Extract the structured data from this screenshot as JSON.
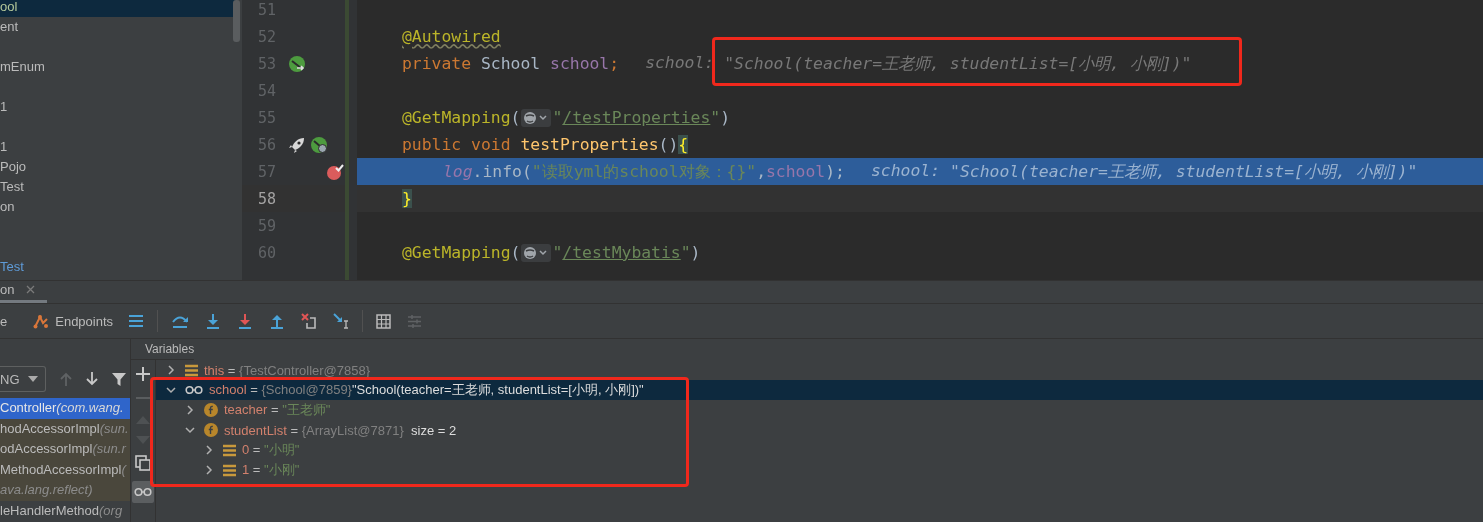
{
  "project_tree": {
    "items": [
      {
        "kind": "file",
        "label": "ool",
        "selected": true
      },
      {
        "kind": "file",
        "label": "ent",
        "selected": false
      },
      {
        "kind": "hidden"
      },
      {
        "kind": "file",
        "label": "mEnum",
        "selected": false
      },
      {
        "kind": "hidden"
      },
      {
        "kind": "file",
        "label": "1",
        "selected": false
      },
      {
        "kind": "hidden"
      },
      {
        "kind": "file",
        "label": "1",
        "selected": false
      },
      {
        "kind": "file",
        "label": "Pojo",
        "selected": false
      },
      {
        "kind": "file",
        "label": "Test",
        "selected": false
      },
      {
        "kind": "file",
        "label": "on",
        "selected": false
      },
      {
        "kind": "hidden"
      },
      {
        "kind": "hidden"
      },
      {
        "kind": "test-file",
        "label": "Test",
        "selected": false
      }
    ]
  },
  "editor": {
    "lines": [
      {
        "number": "51",
        "caret": false
      },
      {
        "number": "52",
        "caret": false,
        "tokens": [
          {
            "kind": "annotation-warn",
            "text": "@Autowired"
          }
        ]
      },
      {
        "number": "53",
        "caret": false,
        "gutter": [
          {
            "kind": "bean"
          }
        ],
        "tokens": [
          {
            "kind": "keyword",
            "text": "private "
          },
          {
            "kind": "plain",
            "text": "School "
          },
          {
            "kind": "field",
            "text": "school"
          },
          {
            "kind": "keyword",
            "text": ";"
          }
        ],
        "hint": {
          "label": "school:",
          "value": "\"School(teacher=王老师, studentList=[小明, 小刚])\""
        }
      },
      {
        "number": "54",
        "caret": false
      },
      {
        "number": "55",
        "caret": false,
        "tokens": [
          {
            "kind": "annotation",
            "text": "@GetMapping"
          },
          {
            "kind": "plain",
            "text": "("
          },
          {
            "kind": "globe"
          },
          {
            "kind": "string",
            "text": "\""
          },
          {
            "kind": "url",
            "text": "/testProperties"
          },
          {
            "kind": "string",
            "text": "\""
          },
          {
            "kind": "plain",
            "text": ")"
          }
        ]
      },
      {
        "number": "56",
        "caret": false,
        "gutter": [
          {
            "kind": "rocket"
          },
          {
            "kind": "web"
          }
        ],
        "tokens": [
          {
            "kind": "keyword",
            "text": "public void "
          },
          {
            "kind": "method",
            "text": "testProperties"
          },
          {
            "kind": "plain",
            "text": "()"
          },
          {
            "kind": "brace",
            "text": "{"
          }
        ]
      },
      {
        "number": "57",
        "current": true,
        "caret": false,
        "breakpoint": true,
        "indented": true,
        "tokens": [
          {
            "kind": "static",
            "text": "log"
          },
          {
            "kind": "plain",
            "text": ".info("
          },
          {
            "kind": "string",
            "text": "\"读取yml的school对象：{}\""
          },
          {
            "kind": "plain",
            "text": ","
          },
          {
            "kind": "field",
            "text": "school"
          },
          {
            "kind": "plain",
            "text": ");"
          }
        ],
        "hint": {
          "label": "school:",
          "value": "\"School(teacher=王老师, studentList=[小明, 小刚])\""
        }
      },
      {
        "number": "58",
        "caret": true,
        "tokens": [
          {
            "kind": "brace",
            "text": "}"
          }
        ]
      },
      {
        "number": "59",
        "caret": false
      },
      {
        "number": "60",
        "caret": false,
        "tokens": [
          {
            "kind": "annotation",
            "text": "@GetMapping"
          },
          {
            "kind": "plain",
            "text": "("
          },
          {
            "kind": "globe"
          },
          {
            "kind": "string",
            "text": "\""
          },
          {
            "kind": "url",
            "text": "/testMybatis"
          },
          {
            "kind": "string",
            "text": "\""
          },
          {
            "kind": "plain",
            "text": ")"
          }
        ]
      }
    ]
  },
  "debug_panel": {
    "tab": {
      "label": "on",
      "selected": true
    },
    "toolbar": {
      "cut_label": "e",
      "endpoints": "Endpoints"
    },
    "frames": {
      "thread_dropdown": "NG",
      "items": [
        {
          "method": "Controller",
          "location": "(com.wang.",
          "selected": true,
          "library": false
        },
        {
          "method": "hodAccessorImpl",
          "location": "(sun.",
          "selected": false,
          "library": true
        },
        {
          "method": "odAccessorImpl",
          "location": "(sun.r",
          "selected": false,
          "library": true
        },
        {
          "method": "MethodAccessorImpl",
          "location": "(",
          "selected": false,
          "library": true
        },
        {
          "location": "ava.lang.reflect)",
          "selected": false,
          "library": true
        },
        {
          "method": "leHandlerMethod",
          "location": "(org",
          "selected": false,
          "library": false
        }
      ]
    },
    "variables": {
      "title": "Variables",
      "items": [
        {
          "kind": "field-list",
          "name": "this",
          "operator": "=",
          "type": "{TestController@7858}",
          "expanded": false,
          "selected": false
        },
        {
          "kind": "watch",
          "name": "school",
          "operator": "=",
          "type": "{School@7859}",
          "value": "\"School(teacher=王老师, studentList=[小明, 小刚])\"",
          "string_value": false,
          "expanded": true,
          "selected": true,
          "children": [
            {
              "kind": "field",
              "name": "teacher",
              "operator": "=",
              "value": "\"王老师\"",
              "string_value": true,
              "expanded": false,
              "selected": false
            },
            {
              "kind": "field",
              "name": "studentList",
              "operator": "=",
              "type": "{ArrayList@7871}",
              "extra": "size = 2",
              "expanded": true,
              "selected": false,
              "children": [
                {
                  "kind": "element",
                  "name": "0",
                  "operator": "=",
                  "value": "\"小明\"",
                  "string_value": true,
                  "expanded": false,
                  "selected": false
                },
                {
                  "kind": "element",
                  "name": "1",
                  "operator": "=",
                  "value": "\"小刚\"",
                  "string_value": true,
                  "expanded": false,
                  "selected": false
                }
              ]
            }
          ]
        }
      ]
    }
  }
}
